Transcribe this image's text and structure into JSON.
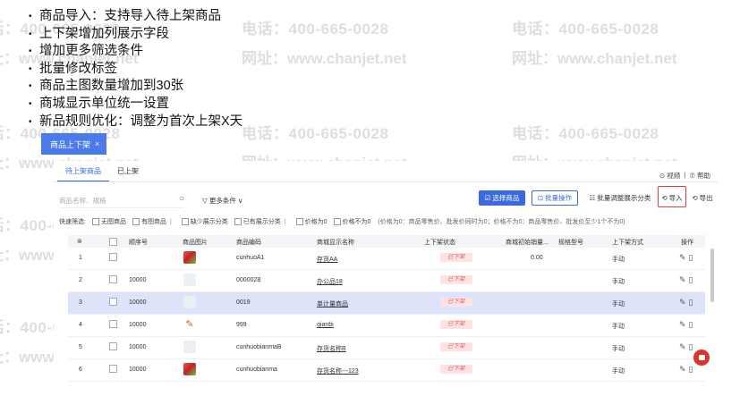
{
  "notes": [
    "商品导入：支持导入待上架商品",
    "上下架增加列展示字段",
    "增加更多筛选条件",
    "批量修改标签",
    "商品主图数量增加到30张",
    "商城显示单位统一设置",
    "新品规则优化：调整为首次上架X天"
  ],
  "doc_tab": {
    "label": "商品上下架",
    "close": "×"
  },
  "subtabs": [
    "待上架商品",
    "已上架"
  ],
  "help": {
    "video": "⊙ 视频",
    "sep": "|",
    "help": "⑦ 帮助"
  },
  "search": {
    "placeholder": "商品名称、规格",
    "icon": "search-icon"
  },
  "more_filters": "▽ 更多条件 ∨",
  "toolbar": {
    "select_goods": "☑ 选择商品",
    "batch_ops": "⊡ 批量操作",
    "batch_category": "☷ 批量调整展示分类",
    "import": "⟲ 导入",
    "export": "⟲ 导出"
  },
  "filters": {
    "label": "快速筛选:",
    "items": [
      "无图商品",
      "有图商品",
      "缺少展示分类",
      "已有展示分类",
      "价格为0",
      "价格不为0"
    ],
    "note": "(价格为0：商品零售价、批发价同时为0；价格不为0：商品零售价、批发价至少1个不为0)"
  },
  "table": {
    "headers": [
      "⊚",
      "",
      "顺序号",
      "商品图片",
      "商品编码",
      "商城显示名称",
      "上下架状态",
      "商城初始销量...",
      "规格型号",
      "上下架方式",
      "操作"
    ],
    "rows": [
      {
        "idx": "1",
        "order": "",
        "code": "cunhuoA1",
        "name": "存货AA",
        "status": "已下架",
        "sales": "0.00",
        "mode": "手动",
        "img": "food"
      },
      {
        "idx": "2",
        "order": "10000",
        "code": "0000028",
        "name": "办公品18",
        "status": "已下架",
        "sales": "",
        "mode": "手动",
        "img": "pale"
      },
      {
        "idx": "3",
        "order": "10000",
        "code": "0019",
        "name": "单计量商品",
        "status": "已下架",
        "sales": "",
        "mode": "手动",
        "img": "pale"
      },
      {
        "idx": "4",
        "order": "10000",
        "code": "999",
        "name": "qianbi",
        "status": "已下架",
        "sales": "",
        "mode": "手动",
        "img": "pencil"
      },
      {
        "idx": "5",
        "order": "10000",
        "code": "cunhuobianmaB",
        "name": "存货名称B",
        "status": "已下架",
        "sales": "",
        "mode": "手动",
        "img": "pale"
      },
      {
        "idx": "6",
        "order": "10000",
        "code": "cunhuobianma",
        "name": "存货名称---123",
        "status": "已下架",
        "sales": "",
        "mode": "手动",
        "img": "food"
      }
    ]
  },
  "watermark": {
    "phone": "电话：400-665-0028",
    "site": "网址：www.chanjet.net"
  },
  "colors": {
    "accent": "#3b6ae0",
    "tab": "#4b7bea",
    "status_bg": "#fde3e3",
    "status_fg": "#e45a5a",
    "highlight": "#e23b3b"
  }
}
